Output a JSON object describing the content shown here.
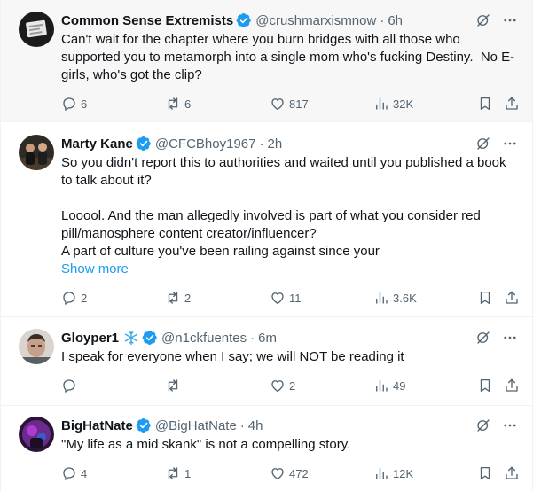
{
  "tweets": [
    {
      "name": "Common Sense Extremists",
      "verified": true,
      "snowflake": false,
      "handle": "@crushmarxismnow",
      "time": "6h",
      "text": "Can't wait for the chapter where you burn bridges with all those who supported you to metamorph into a single mom who's fucking Destiny.  No E-girls, who's got the clip?",
      "show_more": "",
      "replies": "6",
      "reposts": "6",
      "likes": "817",
      "views": "32K"
    },
    {
      "name": "Marty Kane",
      "verified": true,
      "snowflake": false,
      "handle": "@CFCBhoy1967",
      "time": "2h",
      "text": "So you didn't report this to authorities and waited until you published a book to talk about it?\n\nLooool. And the man allegedly involved is part of what you consider red pill/manosphere content creator/influencer?\nA part of culture you've been railing against since your",
      "show_more": "Show more",
      "replies": "2",
      "reposts": "2",
      "likes": "11",
      "views": "3.6K"
    },
    {
      "name": "Gloyper1",
      "verified": true,
      "snowflake": true,
      "handle": "@n1ckfuentes",
      "time": "6m",
      "text": "I speak for everyone when I say; we will NOT be reading it",
      "show_more": "",
      "replies": "",
      "reposts": "",
      "likes": "2",
      "views": "49"
    },
    {
      "name": "BigHatNate",
      "verified": true,
      "snowflake": false,
      "handle": "@BigHatNate",
      "time": "4h",
      "text": "\"My life as a mid skank\" is not a compelling story.",
      "show_more": "",
      "replies": "4",
      "reposts": "1",
      "likes": "472",
      "views": "12K"
    }
  ],
  "icons": {
    "verified": "verified-badge-icon",
    "grok": "grok-icon",
    "more": "more-options-icon",
    "reply": "reply-icon",
    "repost": "repost-icon",
    "like": "like-icon",
    "views": "views-icon",
    "bookmark": "bookmark-icon",
    "share": "share-icon"
  },
  "colors": {
    "accent": "#1d9bf0",
    "text": "#0f1419",
    "secondary": "#536471",
    "highlight_bg": "#f7f7f7",
    "divider": "#eff3f4"
  }
}
